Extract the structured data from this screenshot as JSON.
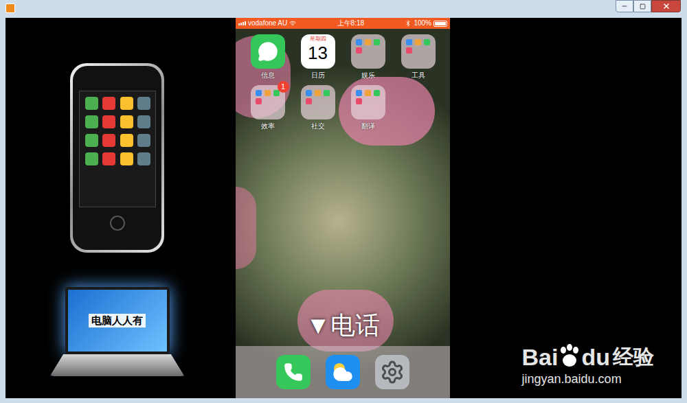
{
  "left_panel": {
    "laptop_label": "电脑人人有"
  },
  "phone": {
    "status_bar": {
      "carrier": "vodafone AU",
      "time": "上午8:18",
      "battery": "100%",
      "battery_level": 1
    },
    "apps": [
      {
        "label": "信息",
        "kind": "messages",
        "badge": ""
      },
      {
        "label": "日历",
        "kind": "calendar",
        "badge": "",
        "weekday": "星期四",
        "day": "13"
      },
      {
        "label": "娱乐",
        "kind": "folder",
        "badge": ""
      },
      {
        "label": "工具",
        "kind": "folder",
        "badge": ""
      },
      {
        "label": "效率",
        "kind": "folder",
        "badge": "1"
      },
      {
        "label": "社交",
        "kind": "folder",
        "badge": ""
      },
      {
        "label": "翻译",
        "kind": "folder",
        "badge": ""
      }
    ],
    "overlay_caption": "▼电话",
    "dock": [
      {
        "kind": "phone"
      },
      {
        "kind": "weather"
      },
      {
        "kind": "settings"
      }
    ]
  },
  "watermark": {
    "brand_left": "Bai",
    "brand_right": "du",
    "brand_cn": "经验",
    "url": "jingyan.baidu.com"
  }
}
